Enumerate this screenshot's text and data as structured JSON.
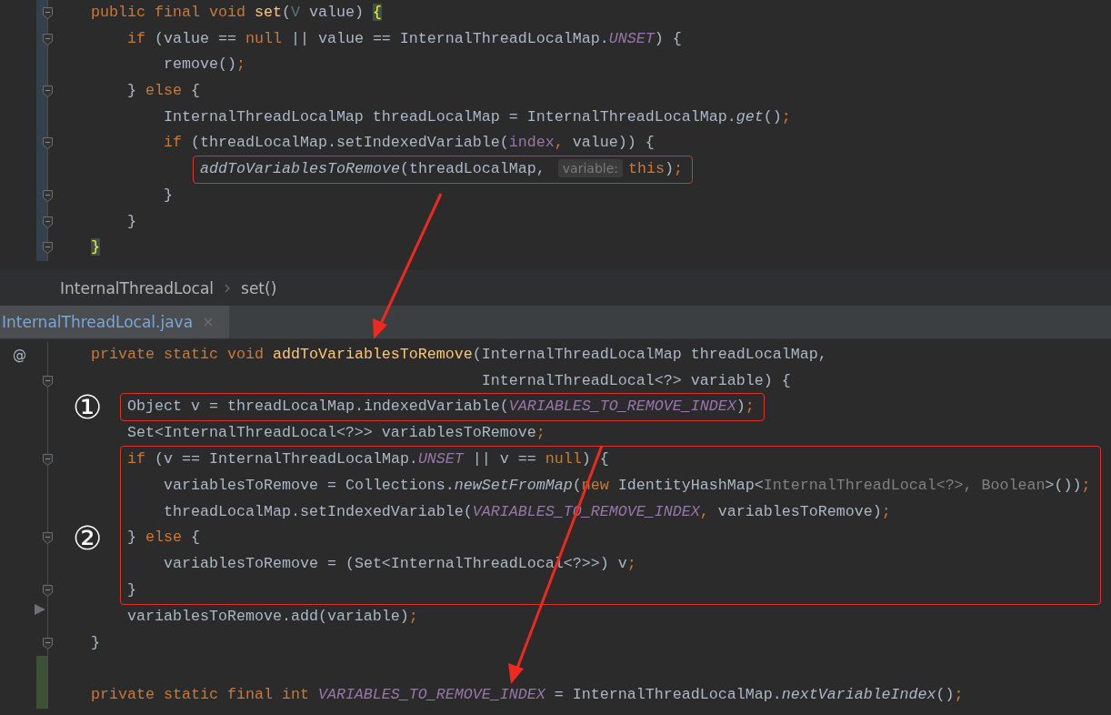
{
  "upper_editor": {
    "lines": [
      {
        "fold_marker": true,
        "tokens": [
          {
            "text": "public final void ",
            "kind": "kw"
          },
          {
            "text": "set",
            "kind": "fn"
          },
          {
            "text": "(",
            "kind": "plain"
          },
          {
            "text": "V",
            "kind": "typeparam"
          },
          {
            "text": " value) ",
            "kind": "plain"
          },
          {
            "text": "{",
            "kind": "match"
          }
        ]
      },
      {
        "fold_marker": true,
        "tokens": [
          {
            "text": "    if ",
            "kind": "kw"
          },
          {
            "text": "(value == ",
            "kind": "plain"
          },
          {
            "text": "null",
            "kind": "kw"
          },
          {
            "text": " || value == InternalThreadLocalMap.",
            "kind": "plain"
          },
          {
            "text": "UNSET",
            "kind": "const"
          },
          {
            "text": ") {",
            "kind": "plain"
          }
        ]
      },
      {
        "tokens": [
          {
            "text": "        remove()",
            "kind": "plain"
          },
          {
            "text": ";",
            "kind": "kw"
          }
        ]
      },
      {
        "fold_marker": true,
        "tokens": [
          {
            "text": "    } ",
            "kind": "plain"
          },
          {
            "text": "else ",
            "kind": "kw"
          },
          {
            "text": "{",
            "kind": "plain"
          }
        ]
      },
      {
        "tokens": [
          {
            "text": "        InternalThreadLocalMap threadLocalMap = InternalThreadLocalMap.",
            "kind": "plain"
          },
          {
            "text": "get",
            "kind": "call"
          },
          {
            "text": "()",
            "kind": "plain"
          },
          {
            "text": ";",
            "kind": "kw"
          }
        ]
      },
      {
        "fold_marker": true,
        "tokens": [
          {
            "text": "        if ",
            "kind": "kw"
          },
          {
            "text": "(threadLocalMap.setIndexedVariable(",
            "kind": "plain"
          },
          {
            "text": "index",
            "kind": "field"
          },
          {
            "text": ", ",
            "kind": "kw"
          },
          {
            "text": "value)) {",
            "kind": "plain"
          }
        ]
      },
      {
        "boxed": true,
        "tokens": [
          {
            "text": "            addToVariablesToRemove",
            "kind": "call"
          },
          {
            "text": "(threadLocalMap, ",
            "kind": "plain"
          },
          {
            "text": "variable:",
            "kind": "hint"
          },
          {
            "text": "this",
            "kind": "kw"
          },
          {
            "text": ")",
            "kind": "plain"
          },
          {
            "text": ";",
            "kind": "kw"
          }
        ]
      },
      {
        "fold_marker": true,
        "tokens": [
          {
            "text": "        }",
            "kind": "plain"
          }
        ]
      },
      {
        "fold_marker": true,
        "tokens": [
          {
            "text": "    }",
            "kind": "plain"
          }
        ]
      },
      {
        "fold_marker": true,
        "tokens": [
          {
            "text": "}",
            "kind": "match"
          }
        ]
      }
    ]
  },
  "breadcrumbs": [
    "InternalThreadLocal",
    "set()"
  ],
  "tabs": [
    {
      "label": "InternalThreadLocal.java",
      "selected": true
    }
  ],
  "editor": {
    "lines": [
      {
        "gutter_text": "@",
        "tokens": [
          {
            "text": "private static void ",
            "kind": "kw"
          },
          {
            "text": "addToVariablesToRemove",
            "kind": "fn"
          },
          {
            "text": "(InternalThreadLocalMap threadLocalMap,",
            "kind": "plain"
          }
        ]
      },
      {
        "fold_marker": true,
        "tokens": [
          {
            "text": "                                           InternalThreadLocal<?> variable) {",
            "kind": "plain"
          }
        ]
      },
      {
        "boxed": true,
        "callout": "①",
        "tokens": [
          {
            "text": "    Object v = threadLocalMap.indexedVariable(",
            "kind": "plain"
          },
          {
            "text": "VARIABLES_TO_REMOVE_INDEX",
            "kind": "const"
          },
          {
            "text": ")",
            "kind": "plain"
          },
          {
            "text": ";",
            "kind": "kw"
          }
        ]
      },
      {
        "tokens": [
          {
            "text": "    Set<InternalThreadLocal<?>> variablesToRemove",
            "kind": "plain"
          },
          {
            "text": ";",
            "kind": "kw"
          }
        ]
      },
      {
        "boxed": true,
        "fold_marker": true,
        "tokens": [
          {
            "text": "    if ",
            "kind": "kw"
          },
          {
            "text": "(v == InternalThreadLocalMap.",
            "kind": "plain"
          },
          {
            "text": "UNSET",
            "kind": "const"
          },
          {
            "text": " || v == ",
            "kind": "plain"
          },
          {
            "text": "null",
            "kind": "kw"
          },
          {
            "text": ") {",
            "kind": "plain"
          }
        ]
      },
      {
        "boxed": true,
        "tokens": [
          {
            "text": "        variablesToRemove = Collections.",
            "kind": "plain"
          },
          {
            "text": "newSetFromMap",
            "kind": "call"
          },
          {
            "text": "(",
            "kind": "plain"
          },
          {
            "text": "new ",
            "kind": "kw"
          },
          {
            "text": "IdentityHashMap<",
            "kind": "plain"
          },
          {
            "text": "InternalThreadLocal<?>, Boolean",
            "kind": "gray"
          },
          {
            "text": ">())",
            "kind": "plain"
          },
          {
            "text": ";",
            "kind": "kw"
          }
        ]
      },
      {
        "boxed": true,
        "tokens": [
          {
            "text": "        threadLocalMap.setIndexedVariable(",
            "kind": "plain"
          },
          {
            "text": "VARIABLES_TO_REMOVE_INDEX",
            "kind": "const"
          },
          {
            "text": ", ",
            "kind": "kw"
          },
          {
            "text": "variablesToRemove)",
            "kind": "plain"
          },
          {
            "text": ";",
            "kind": "kw"
          }
        ]
      },
      {
        "boxed": true,
        "callout": "②",
        "fold_marker": true,
        "tokens": [
          {
            "text": "    } ",
            "kind": "plain"
          },
          {
            "text": "else ",
            "kind": "kw"
          },
          {
            "text": "{",
            "kind": "plain"
          }
        ]
      },
      {
        "boxed": true,
        "tokens": [
          {
            "text": "        variablesToRemove = (Set<InternalThreadLocal<?>>) v",
            "kind": "plain"
          },
          {
            "text": ";",
            "kind": "kw"
          }
        ]
      },
      {
        "boxed": true,
        "fold_marker": true,
        "tokens": [
          {
            "text": "    }",
            "kind": "plain"
          }
        ]
      },
      {
        "run_marker": true,
        "tokens": [
          {
            "text": "    variablesToRemove.add(variable)",
            "kind": "plain"
          },
          {
            "text": ";",
            "kind": "kw"
          }
        ]
      },
      {
        "fold_marker": true,
        "tokens": [
          {
            "text": "}",
            "kind": "plain"
          }
        ]
      },
      {
        "modified": true
      },
      {
        "modified": true,
        "tokens": [
          {
            "text": "private static final int ",
            "kind": "kw"
          },
          {
            "text": "VARIABLES_TO_REMOVE_INDEX",
            "kind": "const"
          },
          {
            "text": " = InternalThreadLocalMap.",
            "kind": "plain"
          },
          {
            "text": "nextVariableIndex",
            "kind": "call"
          },
          {
            "text": "()",
            "kind": "plain"
          },
          {
            "text": ";",
            "kind": "kw"
          }
        ]
      }
    ]
  }
}
